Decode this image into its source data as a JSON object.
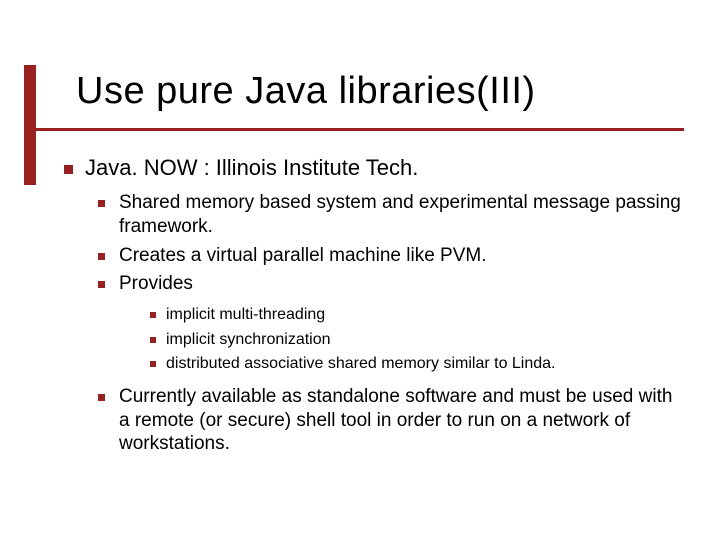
{
  "slide": {
    "title": "Use pure Java libraries(III)",
    "level1": {
      "text": "Java. NOW  :  Illinois Institute Tech."
    },
    "level2": [
      {
        "text": "Shared memory based system and experimental message passing framework."
      },
      {
        "text": "Creates a virtual parallel machine like PVM."
      },
      {
        "text": " Provides"
      }
    ],
    "level3": [
      {
        "text": "implicit multi-threading"
      },
      {
        "text": "implicit synchronization"
      },
      {
        "text": "distributed associative shared memory similar to Linda."
      }
    ],
    "level2b": [
      {
        "text": "Currently available as standalone software and must be used with a remote (or secure) shell tool in order to run on a network of workstations."
      }
    ]
  },
  "colors": {
    "accent": "#9a1f1f"
  }
}
